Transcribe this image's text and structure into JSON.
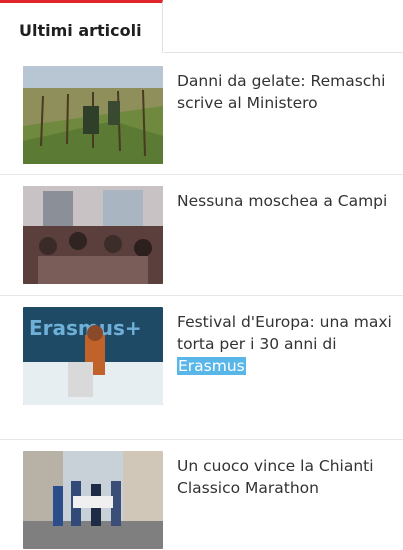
{
  "tabs": {
    "active_label": "Ultimi articoli"
  },
  "articles": [
    {
      "title": "Danni da gelate: Remaschi scrive al Ministero",
      "image": "vineyard-photo"
    },
    {
      "title": "Nessuna moschea a Campi",
      "image": "meeting-room-photo"
    },
    {
      "title_prefix": "Festival d'Europa: una maxi torta per i 30 anni di",
      "title_highlight": "Erasmus",
      "image": "erasmus-cake-photo",
      "image_text": "Erasmus+"
    },
    {
      "title": "Un cuoco vince la Chianti Classico Marathon",
      "image": "marathon-street-photo"
    }
  ],
  "colors": {
    "accent": "#e0262b",
    "selection": "#58b6e8"
  }
}
